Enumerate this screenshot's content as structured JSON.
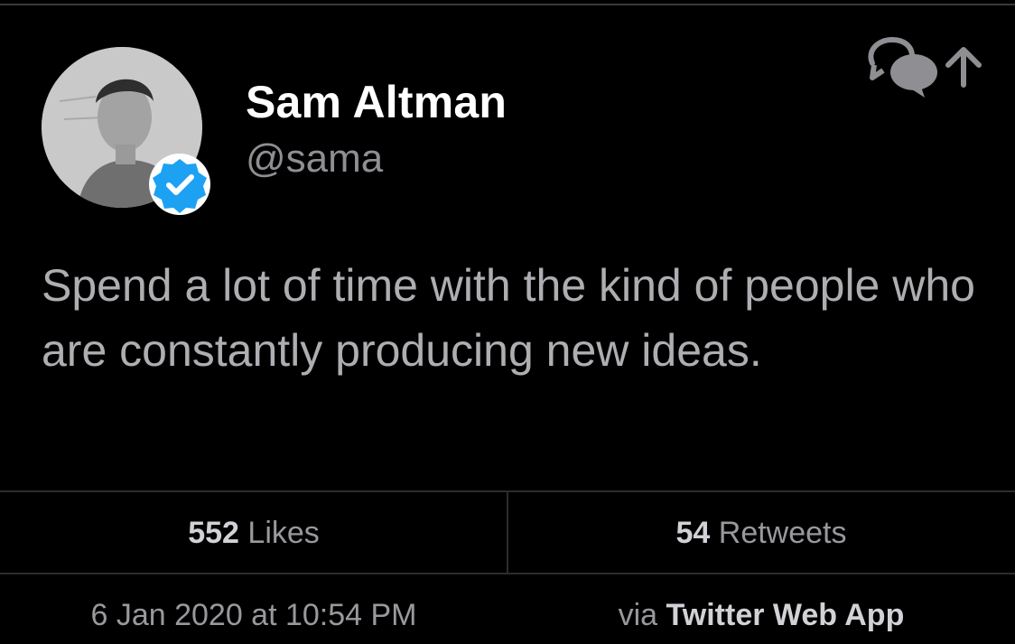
{
  "tweet": {
    "author_name": "Sam Altman",
    "handle": "@sama",
    "text": "Spend a lot of time with the kind of people who are constantly producing new ideas.",
    "stats": {
      "likes_count": "552",
      "likes_label": "Likes",
      "retweets_count": "54",
      "retweets_label": "Retweets"
    },
    "timestamp": "6 Jan 2020 at 10:54 PM",
    "source_prefix": "via",
    "source_app": "Twitter Web App"
  },
  "icons": {
    "reply": "reply-bubbles-icon",
    "share": "share-arrow-icon",
    "verified": "verified-badge-icon"
  },
  "colors": {
    "background": "#000000",
    "verified_blue": "#1da1f2",
    "text_primary": "#ffffff",
    "text_secondary": "#8e8e93"
  }
}
